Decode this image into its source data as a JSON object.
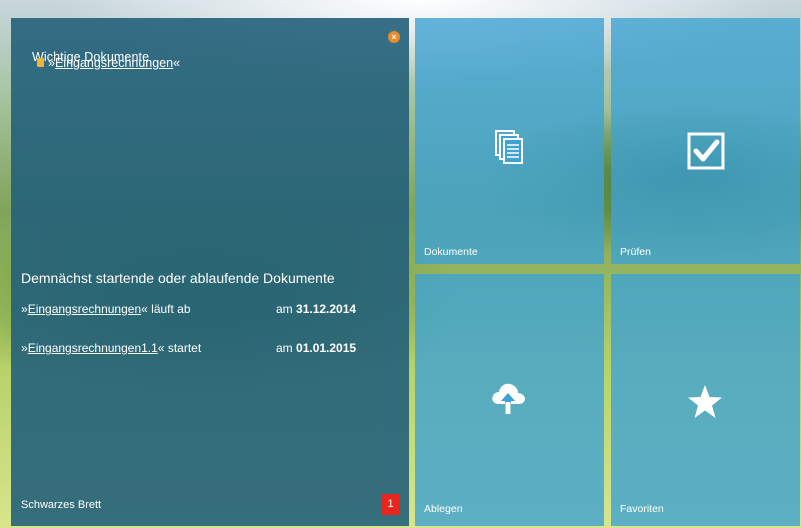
{
  "board": {
    "title": "Wichtige Dokumente",
    "doc_link_prefix": "»",
    "doc_link_text": "Eingangsrechnungen",
    "doc_link_suffix": "«",
    "section_title": "Demnächst startende oder ablaufende Dokumente",
    "rows": [
      {
        "prefix": "»",
        "link": "Eingangsrechnungen",
        "suffix": "«",
        "status": " läuft ab",
        "date_prefix": "am ",
        "date": "31.12.2014"
      },
      {
        "prefix": "»",
        "link": "Eingangsrechnungen1.1",
        "suffix": "«",
        "status": " startet",
        "date_prefix": "am ",
        "date": "01.01.2015"
      }
    ],
    "footer_label": "Schwarzes Brett",
    "badge_count": "1"
  },
  "tiles": {
    "dokumente": {
      "label": "Dokumente",
      "icon": "documents-icon"
    },
    "pruefen": {
      "label": "Prüfen",
      "icon": "checkbox-icon"
    },
    "ablegen": {
      "label": "Ablegen",
      "icon": "cloud-upload-icon"
    },
    "favoriten": {
      "label": "Favoriten",
      "icon": "star-icon"
    }
  },
  "colors": {
    "board_bg": "#24607a",
    "tile_bg": "#3ea2d2",
    "badge": "#e8261d",
    "close": "#e98a2d"
  }
}
